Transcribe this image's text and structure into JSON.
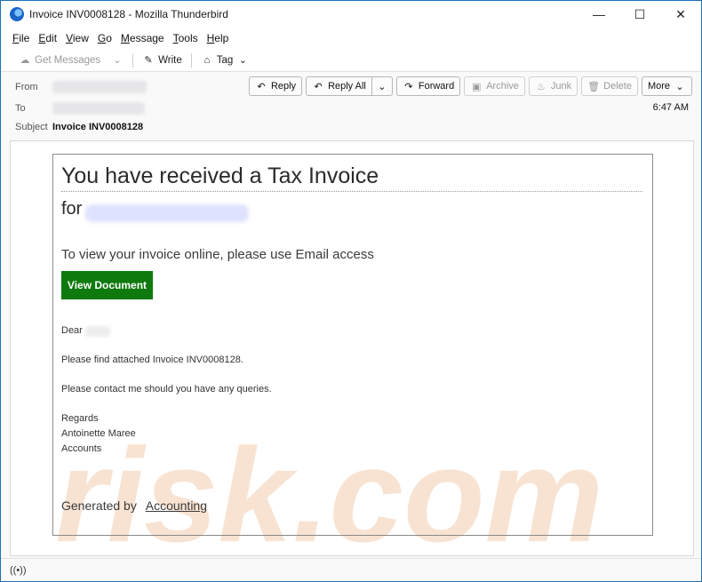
{
  "window": {
    "title": "Invoice INV0008128 - Mozilla Thunderbird",
    "controls": {
      "minimize": "—",
      "maximize": "☐",
      "close": "✕"
    }
  },
  "menu": [
    {
      "label": "File",
      "key": "F"
    },
    {
      "label": "Edit",
      "key": "E"
    },
    {
      "label": "View",
      "key": "V"
    },
    {
      "label": "Go",
      "key": "G"
    },
    {
      "label": "Message",
      "key": "M"
    },
    {
      "label": "Tools",
      "key": "T"
    },
    {
      "label": "Help",
      "key": "H"
    }
  ],
  "toolbar": {
    "get_messages": "Get Messages",
    "write": "Write",
    "tag": "Tag"
  },
  "header": {
    "from_label": "From",
    "to_label": "To",
    "subject_label": "Subject",
    "subject_value": "Invoice INV0008128",
    "time": "6:47 AM",
    "actions": {
      "reply": "Reply",
      "reply_all": "Reply All",
      "forward": "Forward",
      "archive": "Archive",
      "junk": "Junk",
      "delete": "Delete",
      "more": "More"
    }
  },
  "email": {
    "title": "You have received a Tax Invoice",
    "for_prefix": "for",
    "view_text": "To view your invoice online, please use Email access",
    "button_label": "View Document",
    "dear": "Dear",
    "line1": "Please find attached Invoice INV0008128.",
    "line2": "Please contact me should you have any queries.",
    "regards": "Regards",
    "sender_name": "Antoinette Maree",
    "sender_dept": "Accounts",
    "generated_by": "Generated by",
    "generated_link": "Accounting"
  },
  "watermark": {
    "text": "risk.com",
    "color": "#f3c9a8"
  }
}
